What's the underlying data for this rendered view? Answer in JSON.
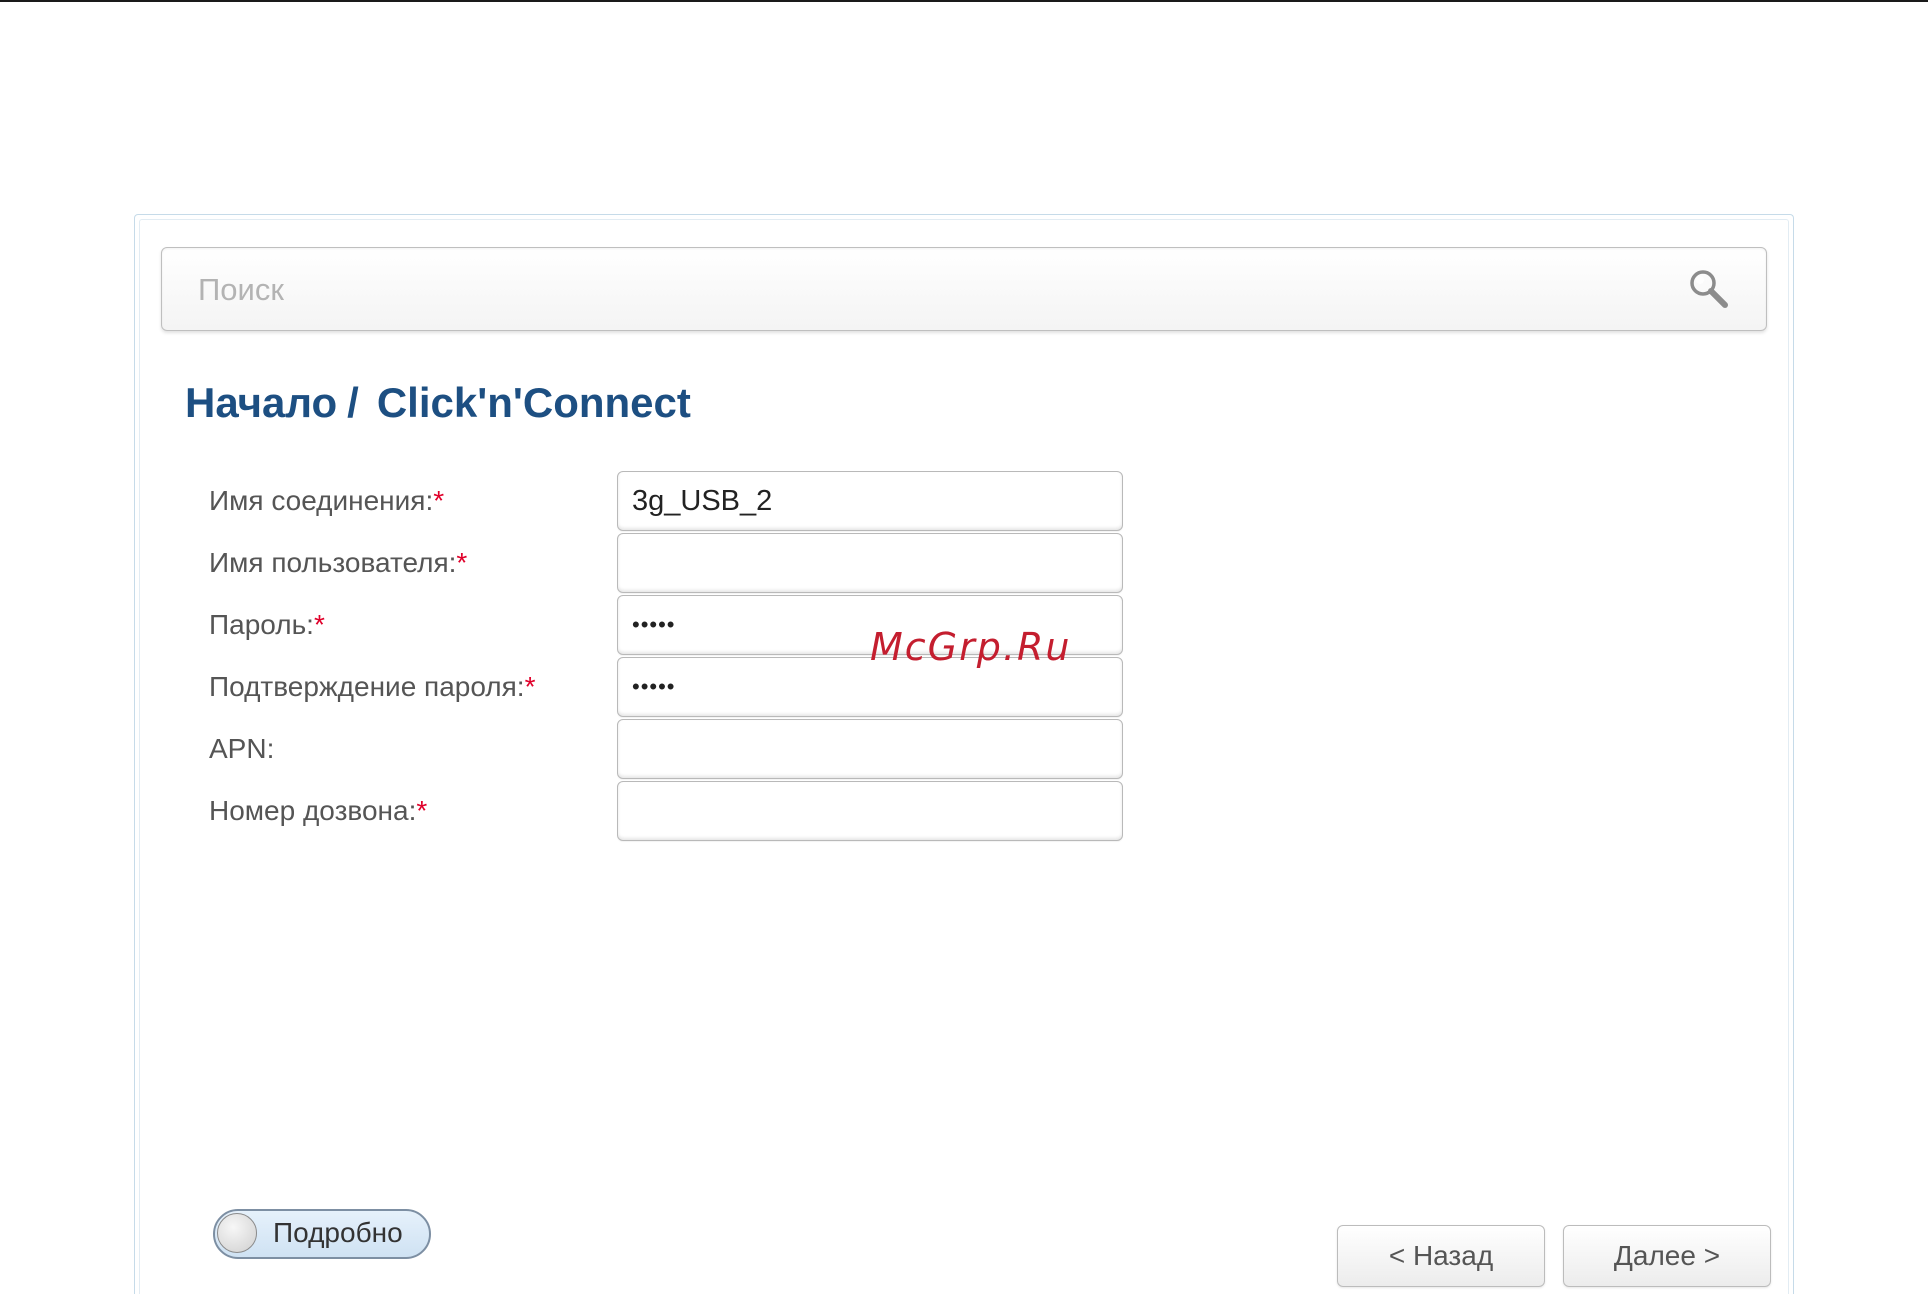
{
  "search": {
    "placeholder": "Поиск",
    "value": ""
  },
  "breadcrumb": {
    "home": "Начало",
    "separator": "/",
    "current": "Click'n'Connect"
  },
  "form": {
    "required_mark": "*",
    "fields": [
      {
        "label": "Имя соединения:",
        "required": true,
        "type": "text",
        "value": "3g_USB_2"
      },
      {
        "label": "Имя пользователя:",
        "required": true,
        "type": "text",
        "value": ""
      },
      {
        "label": "Пароль:",
        "required": true,
        "type": "password",
        "value": "•••••"
      },
      {
        "label": "Подтверждение пароля:",
        "required": true,
        "type": "password",
        "value": "•••••"
      },
      {
        "label": "APN:",
        "required": false,
        "type": "text",
        "value": ""
      },
      {
        "label": "Номер дозвона:",
        "required": true,
        "type": "text",
        "value": ""
      }
    ]
  },
  "watermark": "McGrp.Ru",
  "advanced_toggle": {
    "label": "Подробно",
    "on": false
  },
  "buttons": {
    "back": "< Назад",
    "next": "Далее >"
  },
  "colors": {
    "title": "#1d4f82",
    "required": "#e0002a",
    "watermark": "#c41e2f"
  }
}
